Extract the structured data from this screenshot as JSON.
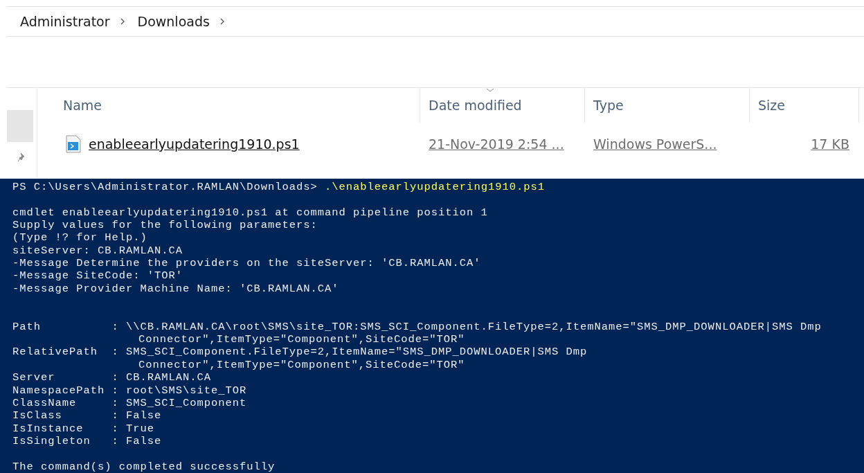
{
  "breadcrumb": [
    {
      "label": "Administrator"
    },
    {
      "label": "Downloads"
    }
  ],
  "file_list": {
    "columns": [
      {
        "label": "Name",
        "sorted": false
      },
      {
        "label": "Date modified",
        "sorted": true
      },
      {
        "label": "Type",
        "sorted": false
      },
      {
        "label": "Size",
        "sorted": false
      }
    ],
    "rows": [
      {
        "name": "enableearlyupdatering1910.ps1",
        "date_modified": "21-Nov-2019 2:54 ...",
        "type": "Windows PowerS...",
        "size": "17 KB",
        "hovered": true
      }
    ]
  },
  "console": {
    "lines": [
      {
        "kind": "prompt",
        "prompt": "PS C:\\Users\\Administrator.RAMLAN\\Downloads>",
        "command": ".\\enableearlyupdatering1910.ps1"
      },
      {
        "kind": "blank"
      },
      {
        "kind": "output",
        "text": "cmdlet enableearlyupdatering1910.ps1 at command pipeline position 1"
      },
      {
        "kind": "output",
        "text": "Supply values for the following parameters:"
      },
      {
        "kind": "output",
        "text": "(Type !? for Help.)"
      },
      {
        "kind": "output",
        "text": "siteServer: CB.RAMLAN.CA"
      },
      {
        "kind": "output",
        "text": "-Message Determine the providers on the siteServer: 'CB.RAMLAN.CA'"
      },
      {
        "kind": "output",
        "text": "-Message SiteCode: 'TOR'"
      },
      {
        "kind": "output",
        "text": "-Message Provider Machine Name: 'CB.RAMLAN.CA'"
      },
      {
        "kind": "blank"
      },
      {
        "kind": "blank"
      },
      {
        "kind": "property",
        "name": "Path",
        "separator": ":",
        "value": "\\\\CB.RAMLAN.CA\\root\\SMS\\site_TOR:SMS_SCI_Component.FileType=2,ItemName=\"SMS_DMP_DOWNLOADER|SMS Dmp"
      },
      {
        "kind": "continuation",
        "text": "Connector\",ItemType=\"Component\",SiteCode=\"TOR\""
      },
      {
        "kind": "property",
        "name": "RelativePath",
        "separator": ":",
        "value": "SMS_SCI_Component.FileType=2,ItemName=\"SMS_DMP_DOWNLOADER|SMS Dmp"
      },
      {
        "kind": "continuation",
        "text": "Connector\",ItemType=\"Component\",SiteCode=\"TOR\""
      },
      {
        "kind": "property",
        "name": "Server",
        "separator": ":",
        "value": "CB.RAMLAN.CA"
      },
      {
        "kind": "property",
        "name": "NamespacePath",
        "separator": ":",
        "value": "root\\SMS\\site_TOR"
      },
      {
        "kind": "property",
        "name": "ClassName",
        "separator": ":",
        "value": "SMS_SCI_Component"
      },
      {
        "kind": "property",
        "name": "IsClass",
        "separator": ":",
        "value": "False"
      },
      {
        "kind": "property",
        "name": "IsInstance",
        "separator": ":",
        "value": "True"
      },
      {
        "kind": "property",
        "name": "IsSingleton",
        "separator": ":",
        "value": "False"
      },
      {
        "kind": "blank"
      },
      {
        "kind": "output",
        "text": "The command(s) completed successfully"
      }
    ]
  }
}
